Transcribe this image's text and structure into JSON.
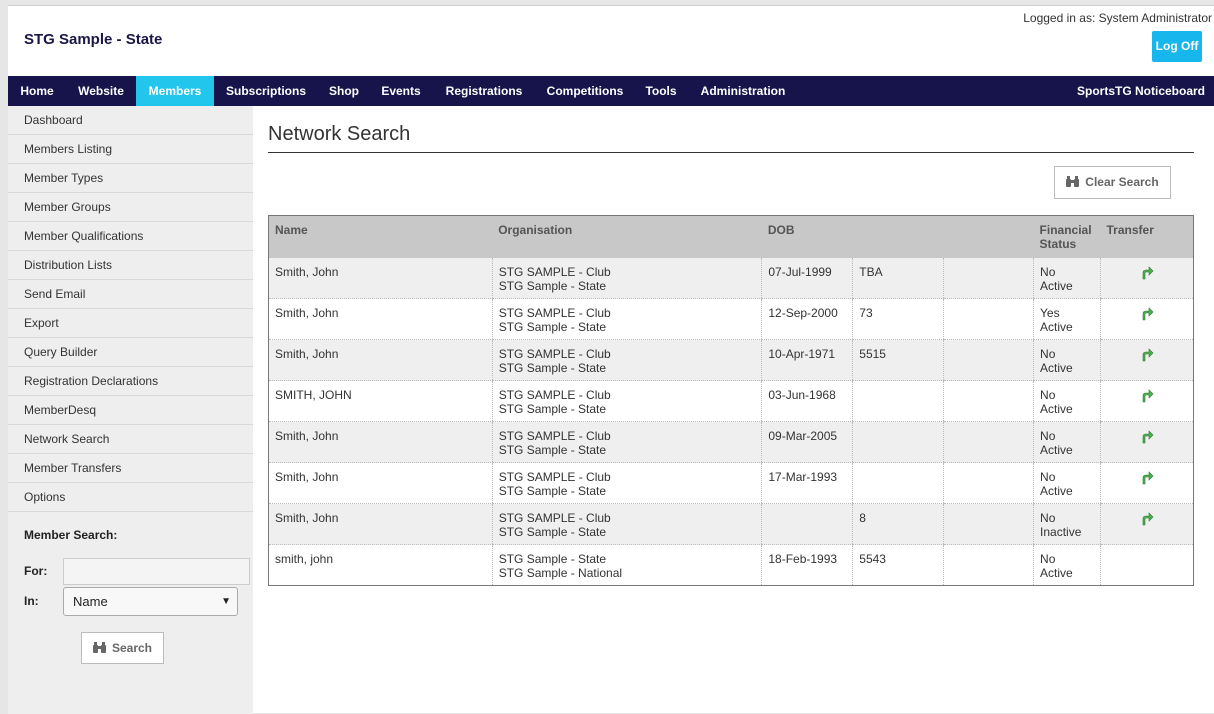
{
  "header": {
    "site_title": "STG Sample - State",
    "logged_in": "Logged in as: System Administrator",
    "logoff_label": "Log Off"
  },
  "nav": {
    "items": [
      "Home",
      "Website",
      "Members",
      "Subscriptions",
      "Shop",
      "Events",
      "Registrations",
      "Competitions",
      "Tools",
      "Administration"
    ],
    "active": "Members",
    "right_label": "SportsTG Noticeboard"
  },
  "sidebar": {
    "items": [
      "Dashboard",
      "Members Listing",
      "Member Types",
      "Member Groups",
      "Member Qualifications",
      "Distribution Lists",
      "Send Email",
      "Export",
      "Query Builder",
      "Registration Declarations",
      "MemberDesq",
      "Network Search",
      "Member Transfers",
      "Options"
    ],
    "member_search": {
      "title": "Member Search:",
      "for_label": "For:",
      "for_value": "",
      "in_label": "In:",
      "in_selected": "Name",
      "search_label": "Search"
    }
  },
  "main": {
    "title": "Network Search",
    "clear_label": "Clear Search",
    "columns": [
      "Name",
      "Organisation",
      "DOB",
      "",
      "",
      "Financial Status",
      "Transfer"
    ],
    "rows": [
      {
        "name": "Smith, John",
        "org1": "STG SAMPLE - Club",
        "org2": "STG Sample - State",
        "dob": "07-Jul-1999",
        "num": "TBA",
        "extra": "",
        "financial": "No",
        "status": "Active",
        "transfer": true
      },
      {
        "name": "Smith, John",
        "org1": "STG SAMPLE - Club",
        "org2": "STG Sample - State",
        "dob": "12-Sep-2000",
        "num": "73",
        "extra": "",
        "financial": "Yes",
        "status": "Active",
        "transfer": true
      },
      {
        "name": "Smith, John",
        "org1": "STG SAMPLE - Club",
        "org2": "STG Sample - State",
        "dob": "10-Apr-1971",
        "num": "5515",
        "extra": "",
        "financial": "No",
        "status": "Active",
        "transfer": true
      },
      {
        "name": "SMITH, JOHN",
        "org1": "STG SAMPLE - Club",
        "org2": "STG Sample - State",
        "dob": "03-Jun-1968",
        "num": "",
        "extra": "",
        "financial": "No",
        "status": "Active",
        "transfer": true
      },
      {
        "name": "Smith, John",
        "org1": "STG SAMPLE - Club",
        "org2": "STG Sample - State",
        "dob": "09-Mar-2005",
        "num": "",
        "extra": "",
        "financial": "No",
        "status": "Active",
        "transfer": true
      },
      {
        "name": "Smith, John",
        "org1": "STG SAMPLE - Club",
        "org2": "STG Sample - State",
        "dob": "17-Mar-1993",
        "num": "",
        "extra": "",
        "financial": "No",
        "status": "Active",
        "transfer": true
      },
      {
        "name": "Smith, John",
        "org1": "STG SAMPLE - Club",
        "org2": "STG Sample - State",
        "dob": "",
        "num": "8",
        "extra": "",
        "financial": "No",
        "status": "Inactive",
        "transfer": true
      },
      {
        "name": "smith, john",
        "org1": "STG Sample - State",
        "org2": "STG Sample - National",
        "dob": "18-Feb-1993",
        "num": "5543",
        "extra": "",
        "financial": "No",
        "status": "Active",
        "transfer": false
      }
    ]
  },
  "colors": {
    "nav_bg": "#16144a",
    "nav_active": "#22c6ed",
    "logoff_bg": "#17b6ec",
    "transfer_icon": "#4caf50"
  },
  "icons": {
    "transfer": "transfer-arrow-icon",
    "search": "binoculars-icon"
  }
}
